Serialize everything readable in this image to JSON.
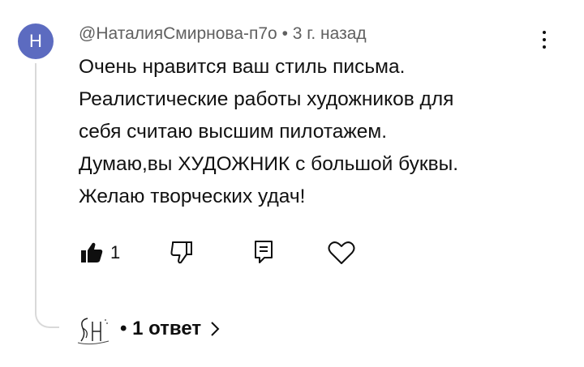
{
  "author": {
    "avatar_letter": "Н",
    "avatar_color": "#5c6bc0",
    "name": "@НаталияСмирнова-п7о",
    "separator": "•",
    "time": "3 г. назад"
  },
  "comment": {
    "lines": [
      "Очень нравится ваш стиль письма.",
      "Реалистические работы художников для",
      "себя считаю высшим пилотажем.",
      "Думаю,вы ХУДОЖНИК с большой буквы.",
      "Желаю творческих удач!"
    ]
  },
  "actions": {
    "like_icon": "thumbs-up-filled-icon",
    "like_count": "1",
    "dislike_icon": "thumbs-down-outline-icon",
    "reply_icon": "reply-comment-icon",
    "heart_icon": "heart-outline-icon"
  },
  "replies": {
    "creator_avatar_icon": "channel-signature-logo",
    "label": "• 1 ответ",
    "chevron_icon": "chevron-right-icon"
  },
  "menu": {
    "icon": "more-vertical-icon"
  }
}
